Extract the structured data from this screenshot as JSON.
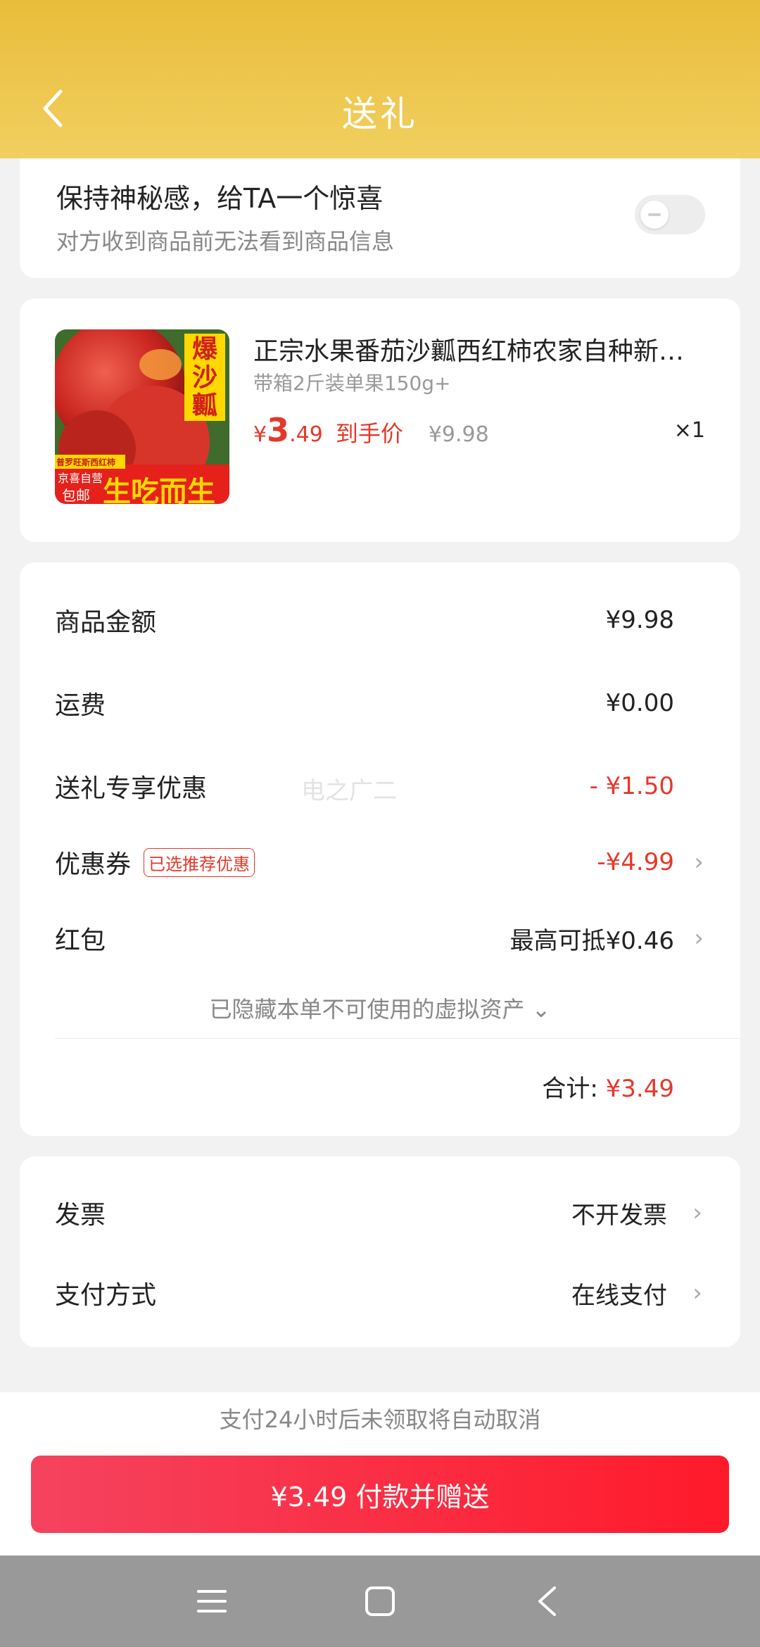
{
  "header": {
    "title": "送礼",
    "back_icon": "chevron-left-icon"
  },
  "surprise": {
    "title": "保持神秘感，给TA一个惊喜",
    "description": "对方收到商品前无法看到商品信息",
    "toggle_on": false
  },
  "product": {
    "image_text": {
      "big": [
        "爆",
        "沙",
        "瓤"
      ],
      "small1": "普罗旺斯西红柿",
      "small2": "京喜自营",
      "small3": "包邮",
      "slogan": "生吃而生"
    },
    "name": "正宗水果番茄沙瓤西红柿农家自种新…",
    "spec": "带箱2斤装单果150g+",
    "price_symbol": "¥",
    "price_int": "3",
    "price_dec": ".49",
    "price_tag": "到手价",
    "original_price": "¥9.98",
    "quantity": "×1"
  },
  "summary": {
    "goods_amount_label": "商品金额",
    "goods_amount_value": "¥9.98",
    "shipping_label": "运费",
    "shipping_value": "¥0.00",
    "gift_discount_label": "送礼专享优惠",
    "gift_discount_value": "- ¥1.50",
    "coupon_label": "优惠券",
    "coupon_badge": "已选推荐优惠",
    "coupon_value": "-¥4.99",
    "redpacket_label": "红包",
    "redpacket_value": "最高可抵¥0.46",
    "hidden_assets": "已隐藏本单不可使用的虚拟资产 ⌄",
    "total_label": "合计: ",
    "total_value": "¥3.49"
  },
  "watermark": "电之广二",
  "invoice": {
    "label": "发票",
    "value": "不开发票"
  },
  "payment": {
    "label": "支付方式",
    "value": "在线支付"
  },
  "notice": "支付24小时后未领取将自动取消",
  "pay_button": "¥3.49 付款并赠送",
  "colors": {
    "header_yellow": "#f1cb52",
    "accent_red": "#e5382a",
    "button_red": "#ff1a2a"
  }
}
